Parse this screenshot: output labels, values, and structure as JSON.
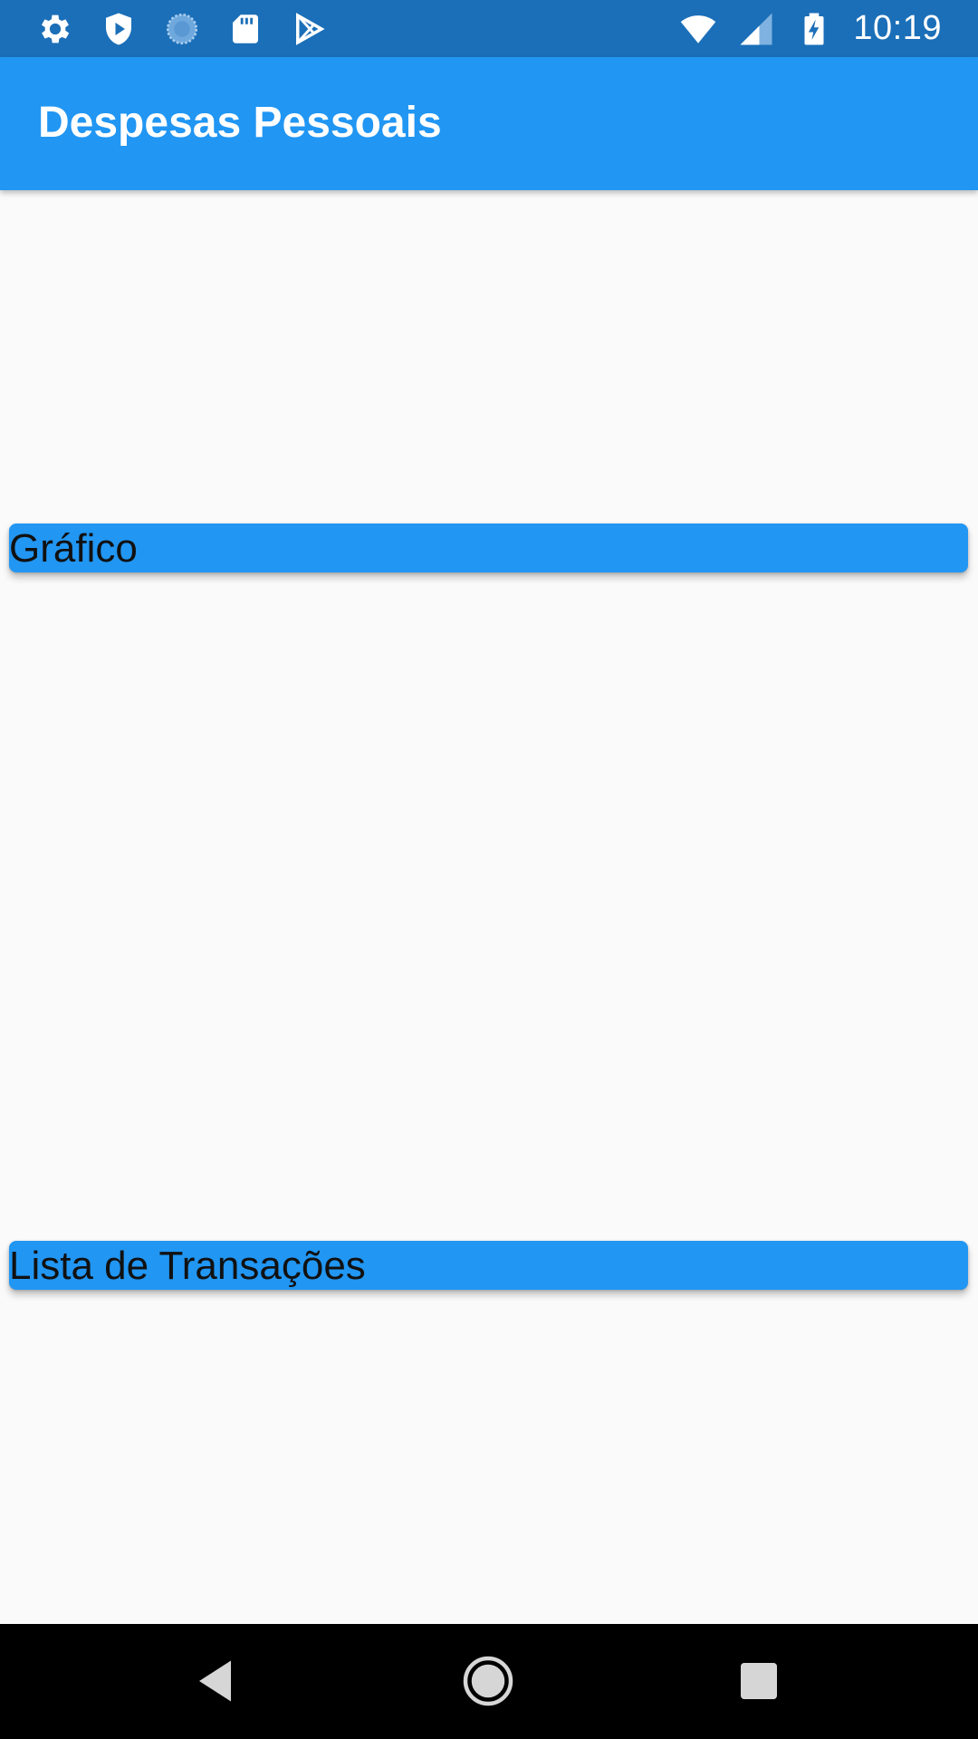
{
  "status_bar": {
    "left_icons": [
      "settings-icon",
      "shield-play-icon",
      "loading-circle-icon",
      "sd-card-icon",
      "play-store-icon"
    ],
    "right_icons": [
      "wifi-icon",
      "cell-signal-icon",
      "battery-charging-icon"
    ],
    "time": "10:19"
  },
  "app_bar": {
    "title": "Despesas Pessoais",
    "color": "#2196f3"
  },
  "main": {
    "chart_card": {
      "label": "Gráfico"
    },
    "list_card": {
      "label": "Lista de Transações"
    }
  },
  "nav_bar": {
    "buttons": [
      "back-icon",
      "home-icon",
      "recents-icon"
    ]
  },
  "colors": {
    "status_bar": "#1b6fb8",
    "primary": "#2196f3",
    "background": "#fafafa",
    "nav_bar": "#000000"
  }
}
